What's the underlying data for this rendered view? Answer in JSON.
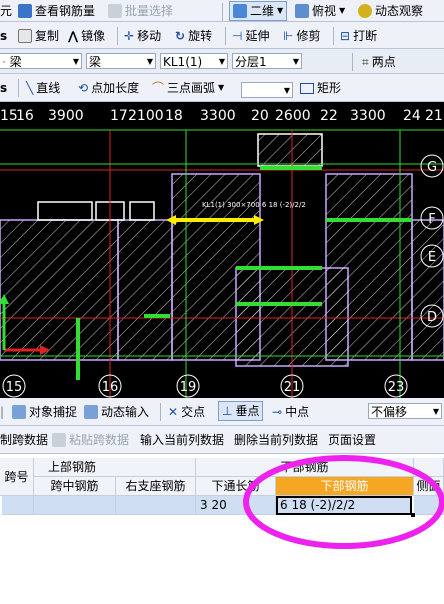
{
  "toolbar1": {
    "item_yuan": "元",
    "view_rebar": "查看钢筋量",
    "batch_select": "批量选择",
    "view_2d": "二维",
    "view_top": "俯视",
    "dynamic_observe": "动态观察"
  },
  "toolbar2": {
    "copy": "复制",
    "mirror": "镜像",
    "move": "移动",
    "rotate": "旋转",
    "extend": "延伸",
    "trim": "修剪",
    "break": "打断"
  },
  "toolbar3": {
    "category": "梁",
    "type": "梁",
    "member": "KL1(1)",
    "layer": "分层1",
    "two_point": "两点"
  },
  "toolbar4": {
    "line": "直线",
    "point_length": "点加长度",
    "three_point_arc": "三点画弧",
    "rectangle": "矩形"
  },
  "cad": {
    "top_dims": [
      "3900",
      "17",
      "2100",
      "18",
      "3300",
      "20",
      "2600",
      "22",
      "3300",
      "24",
      "21"
    ],
    "top_left_axis": "15",
    "top_left_dim": "16",
    "bottom_axes": [
      "15",
      "16",
      "19",
      "21",
      "23"
    ],
    "right_axes": [
      "G",
      "F",
      "E",
      "D"
    ],
    "annotation": "KL1(1) 300×700\n6 18 (-2)/2/2"
  },
  "statusbar": {
    "object_snap": "对象捕捉",
    "dynamic_input": "动态输入",
    "intersection": "交点",
    "perpendicular": "垂点",
    "midpoint": "中点",
    "offset": "不偏移"
  },
  "grid_toolbar": {
    "copy_span": "制跨数据",
    "paste_span": "粘贴跨数据",
    "input_col": "输入当前列数据",
    "delete_col": "删除当前列数据",
    "page_setup": "页面设置"
  },
  "table": {
    "span_no": "跨号",
    "top_rebar": "上部钢筋",
    "bottom_rebar_group": "下部钢筋",
    "mid_rebar": "跨中钢筋",
    "right_support": "右支座钢筋",
    "bottom_through": "下通长筋",
    "bottom_rebar": "下部钢筋",
    "side_rebar": "侧面",
    "row1_through": "3 20",
    "row1_bottom": "6 18 (-2)/2/2"
  },
  "colors": {
    "highlight_circle": "#ee22ee",
    "cad_background": "#000000",
    "beam_outline": "#c8a8ff",
    "selected_green": "#33dd33",
    "selected_yellow": "#ffee00"
  }
}
